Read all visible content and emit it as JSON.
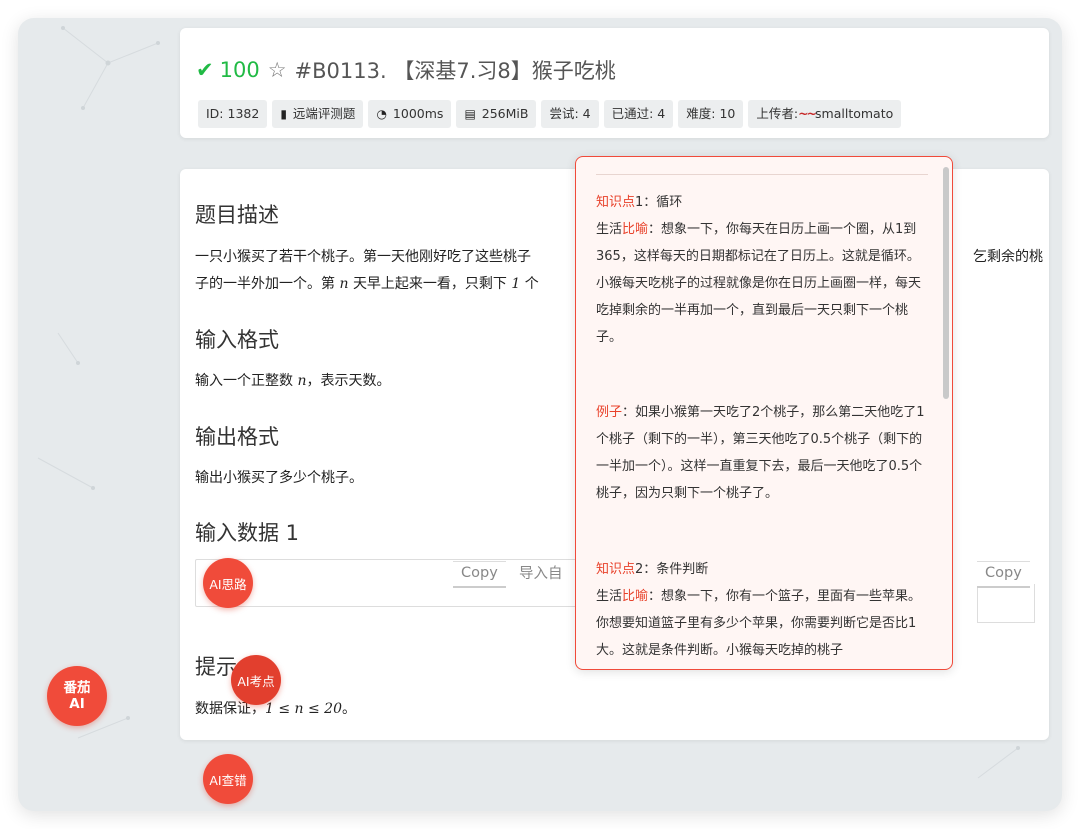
{
  "header": {
    "score": "100",
    "title": "#B0113. 【深基7.习8】猴子吃桃",
    "tags": [
      {
        "icon": "",
        "label": "ID: 1382"
      },
      {
        "icon": "bookmark-icon",
        "label": "远端评测题"
      },
      {
        "icon": "stopwatch-icon",
        "label": "1000ms"
      },
      {
        "icon": "memory-icon",
        "label": "256MiB"
      },
      {
        "icon": "",
        "label": "尝试: 4"
      },
      {
        "icon": "",
        "label": "已通过: 4"
      },
      {
        "icon": "",
        "label": "难度: 10"
      }
    ],
    "uploader_label": "上传者:",
    "uploader_name": "smalltomato"
  },
  "content": {
    "desc_heading": "题目描述",
    "desc_line1_a": "一只小猴买了若干个桃子。第一天他刚好吃了这些桃子",
    "desc_line1_b": "乞剩余的桃",
    "desc_line2_a": "子的一半外加一个。第",
    "desc_var_n": "n",
    "desc_line2_b": "天早上起来一看，只剩下",
    "desc_one": "1",
    "desc_line2_c": "个",
    "input_heading": "输入格式",
    "input_text_a": "输入一个正整数",
    "input_var": "n",
    "input_text_b": "，表示天数。",
    "output_heading": "输出格式",
    "output_text": "输出小猴买了多少个桃子。",
    "sample_heading": "输入数据 1",
    "copy_label": "Copy",
    "import_label": "导入自",
    "copy_label_2": "Copy",
    "hint_heading": "提示",
    "hint_text_a": "数据保证，",
    "hint_math": "1 ≤ n ≤ 20",
    "hint_text_b": "。"
  },
  "popup": {
    "k1_label": "知识点",
    "k1_rest": "1：循环",
    "life_a": "生活",
    "metaphor": "比喻",
    "k1_body": "：想象一下，你每天在日历上画一个圈，从1到365，这样每天的日期都标记在了日历上。这就是循环。小猴每天吃桃子的过程就像是你在日历上画圈一样，每天吃掉剩余的一半再加一个，直到最后一天只剩下一个桃子。",
    "ex_label": "例子",
    "ex_body": "：如果小猴第一天吃了2个桃子，那么第二天他吃了1个桃子（剩下的一半），第三天他吃了0.5个桃子（剩下的一半加一个）。这样一直重复下去，最后一天他吃了0.5个桃子，因为只剩下一个桃子了。",
    "k2_label": "知识点",
    "k2_rest": "2：条件判断",
    "life_b": "生活",
    "metaphor_b": "比喻",
    "k2_body": "：想象一下，你有一个篮子，里面有一些苹果。你想要知道篮子里有多少个苹果，你需要判断它是否比1大。这就是条件判断。小猴每天吃掉的桃子"
  },
  "fabs": {
    "ai_thinking": "AI思路",
    "ai_points": "AI考点",
    "ai_debug": "AI查错",
    "fanqie_line1": "番茄",
    "fanqie_line2": "AI"
  },
  "colors": {
    "accent_red": "#f04b3a",
    "success_green": "#21ba45"
  }
}
